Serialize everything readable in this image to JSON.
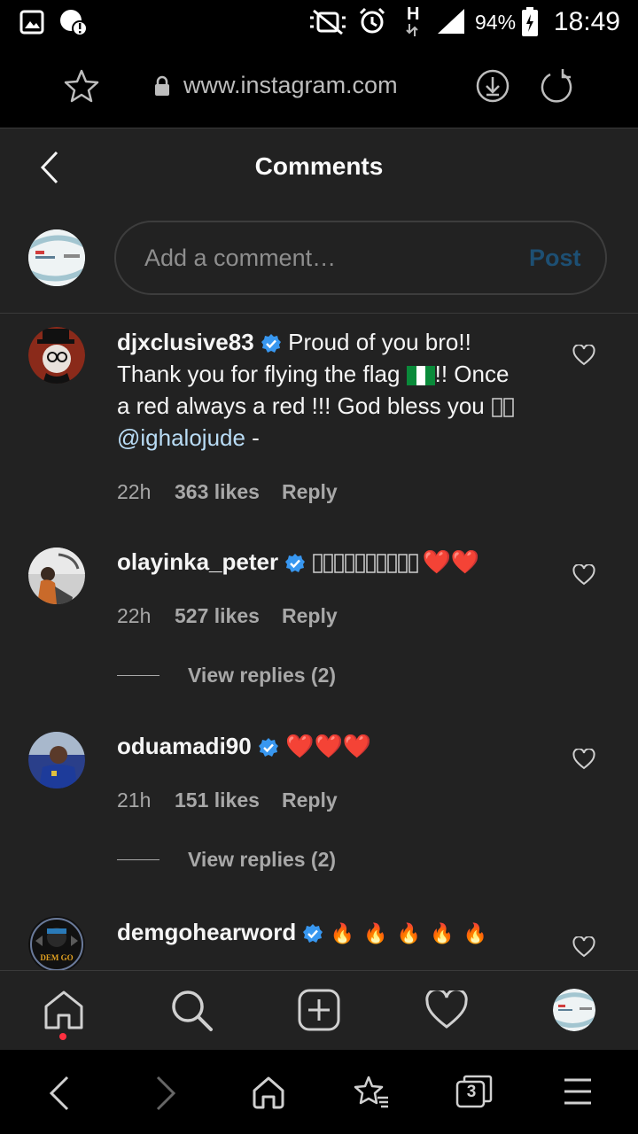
{
  "status_bar": {
    "battery": "94%",
    "time": "18:49",
    "network": "H",
    "icons": [
      "gallery-icon",
      "alert-icon",
      "mute-icon",
      "alarm-icon",
      "signal-icon",
      "battery-icon"
    ]
  },
  "browser": {
    "url": "www.instagram.com",
    "icons": [
      "star-icon",
      "lock-icon",
      "download-icon",
      "reload-icon"
    ]
  },
  "header": {
    "title": "Comments"
  },
  "composer": {
    "placeholder": "Add a comment…",
    "post_label": "Post"
  },
  "comments": [
    {
      "user": "djxclusive83",
      "verified": true,
      "text_1": "Proud of you bro!!",
      "text_2": "Thank you for flying the flag",
      "text_2b": "!! Once",
      "text_3": "a red always a red !!! God bless you",
      "mention": "@ighalojude",
      "text_4": " -",
      "time": "22h",
      "likes": "363 likes",
      "reply": "Reply"
    },
    {
      "user": "olayinka_peter",
      "verified": true,
      "text": "❤️❤️",
      "time": "22h",
      "likes": "527 likes",
      "reply": "Reply",
      "view_replies": "View replies (2)"
    },
    {
      "user": "oduamadi90",
      "verified": true,
      "text": "❤️❤️❤️",
      "time": "21h",
      "likes": "151 likes",
      "reply": "Reply",
      "view_replies": "View replies (2)"
    },
    {
      "user": "demgohearword",
      "verified": true,
      "text": "🔥 🔥 🔥 🔥 🔥",
      "avatar_text": "DEM GO"
    }
  ],
  "colors": {
    "background": "#222222",
    "post_button": "#1d4f73",
    "mention": "#b9dcf5",
    "verified": "#3897f0",
    "heart": "#e8243a",
    "notification_dot": "#ff3040"
  },
  "bottom_nav": [
    "home-icon",
    "search-icon",
    "add-post-icon",
    "activity-heart-icon",
    "profile-avatar"
  ],
  "system_nav": {
    "tabs_count": "3",
    "icons": [
      "back-icon",
      "forward-icon",
      "home-icon",
      "bookmarks-icon",
      "tabs-icon",
      "menu-icon"
    ]
  }
}
